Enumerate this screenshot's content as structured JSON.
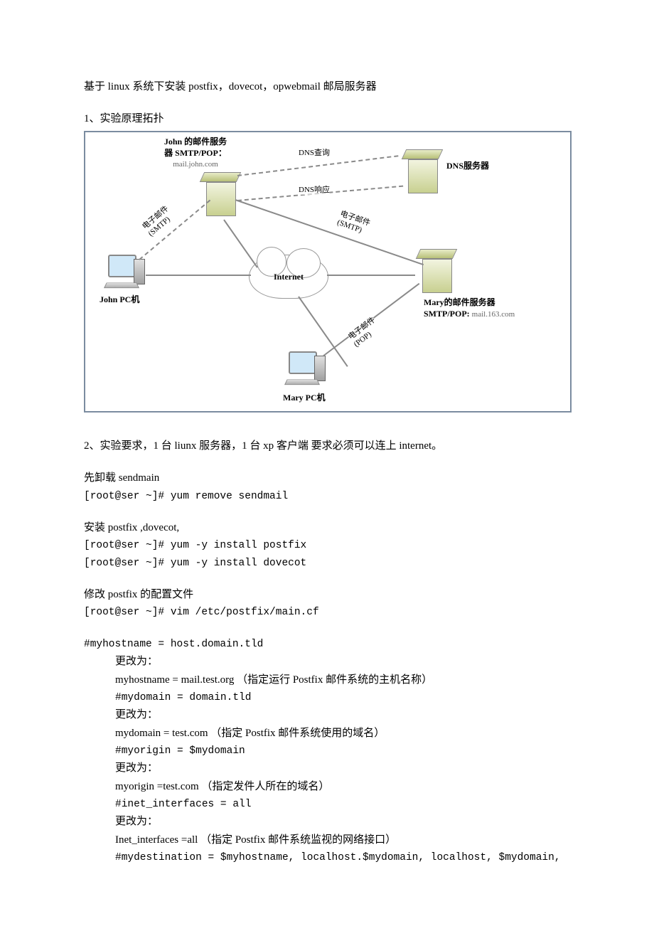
{
  "title": "基于 linux 系统下安装 postfix，dovecot，opwebmail 邮局服务器",
  "section1": {
    "heading": "1、实验原理拓扑"
  },
  "diagram": {
    "john_server_label_line1": "John 的邮件服务",
    "john_server_label_line2": "器 SMTP/POP：",
    "john_server_host": "mail.john.com",
    "dns_server_label": "DNS服务器",
    "john_pc_label": "John PC机",
    "mary_pc_label": "Mary PC机",
    "mary_server_label_line1": "Mary的邮件服务器",
    "mary_server_label_line2": "SMTP/POP:",
    "mary_server_host": "mail.163.com",
    "internet_label": "Internet",
    "edge_dns_query": "DNS查询",
    "edge_dns_response": "DNS响应",
    "edge_smtp_1": "电子邮件",
    "edge_smtp_1b": "(SMTP)",
    "edge_smtp_2": "电子邮件",
    "edge_smtp_2b": "(SMTP)",
    "edge_pop": "电子邮件",
    "edge_pop_b": "(POP)"
  },
  "section2": {
    "heading": "2、实验要求，1 台 liunx 服务器，1 台 xp 客户端 要求必须可以连上 internet。",
    "uninstall_label": "先卸载 sendmain",
    "uninstall_cmd": "[root@ser ~]# yum remove sendmail",
    "install_label": "安装 postfix ,dovecot,",
    "install_cmd1": "[root@ser ~]# yum -y install postfix",
    "install_cmd2": "[root@ser ~]# yum -y install dovecot",
    "edit_label": "修改 postfix 的配置文件",
    "edit_cmd": "[root@ser ~]# vim /etc/postfix/main.cf",
    "cfg_myhostname_comment": "#myhostname = host.domain.tld",
    "cfg_change_to": "更改为：",
    "cfg_myhostname_val": "myhostname = mail.test.org （指定运行 Postfix 邮件系统的主机名称）",
    "cfg_mydomain_comment": "#mydomain = domain.tld",
    "cfg_mydomain_val": "mydomain = test.com （指定 Postfix 邮件系统使用的域名）",
    "cfg_myorigin_comment": "#myorigin = $mydomain",
    "cfg_myorigin_val": "myorigin =test.com （指定发件人所在的域名）",
    "cfg_inet_comment": "#inet_interfaces = all",
    "cfg_inet_val": "Inet_interfaces =all （指定 Postfix 邮件系统监视的网络接口）",
    "cfg_mydest_comment": "#mydestination = $myhostname, localhost.$mydomain, localhost, $mydomain,"
  }
}
